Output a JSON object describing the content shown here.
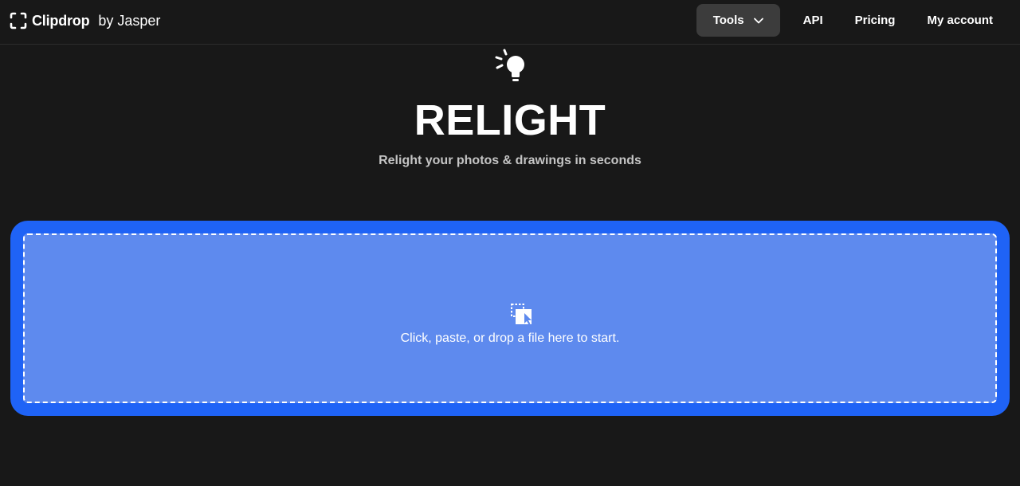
{
  "header": {
    "brand": {
      "name": "Clipdrop",
      "suffix": "by Jasper",
      "icon": "clipdrop-logo-icon"
    },
    "nav": [
      {
        "label": "Tools",
        "icon": "chevron-down-icon"
      },
      {
        "label": "API"
      },
      {
        "label": "Pricing"
      },
      {
        "label": "My account"
      }
    ]
  },
  "hero": {
    "icon": "lightbulb-icon",
    "title": "RELIGHT",
    "subtitle": "Relight your photos & drawings in seconds"
  },
  "dropzone": {
    "icon": "upload-drop-icon",
    "text": "Click, paste, or drop a file here to start."
  },
  "colors": {
    "background": "#181818",
    "tools_button_bg": "#3c3c3c",
    "dropzone_outer": "#1f63f6",
    "dropzone_inner": "#5e8aee",
    "subtitle": "#c4c4c4"
  }
}
